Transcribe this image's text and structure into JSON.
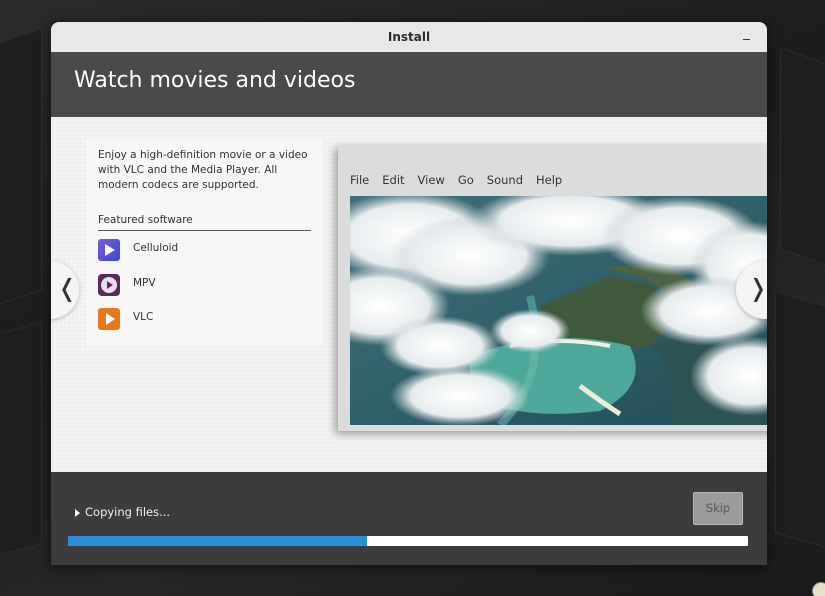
{
  "window": {
    "title": "Install"
  },
  "slide": {
    "title": "Watch movies and videos",
    "description": "Enjoy a high-definition movie or a video with VLC and the Media Player. All modern codecs are supported.",
    "featured_label": "Featured software",
    "apps": [
      {
        "name": "Celluloid",
        "icon": "celluloid-icon"
      },
      {
        "name": "MPV",
        "icon": "mpv-icon"
      },
      {
        "name": "VLC",
        "icon": "vlc-icon"
      }
    ],
    "screenshot_menu": [
      "File",
      "Edit",
      "View",
      "Go",
      "Sound",
      "Help"
    ],
    "prev_glyph": "❬",
    "next_glyph": "❭"
  },
  "footer": {
    "status": "Copying files...",
    "skip_label": "Skip",
    "progress_fraction": 0.44
  },
  "colors": {
    "progress_fill": "#2a8fd6",
    "header_bg": "#4a4a4a",
    "footer_bg": "#3c3c3c"
  }
}
